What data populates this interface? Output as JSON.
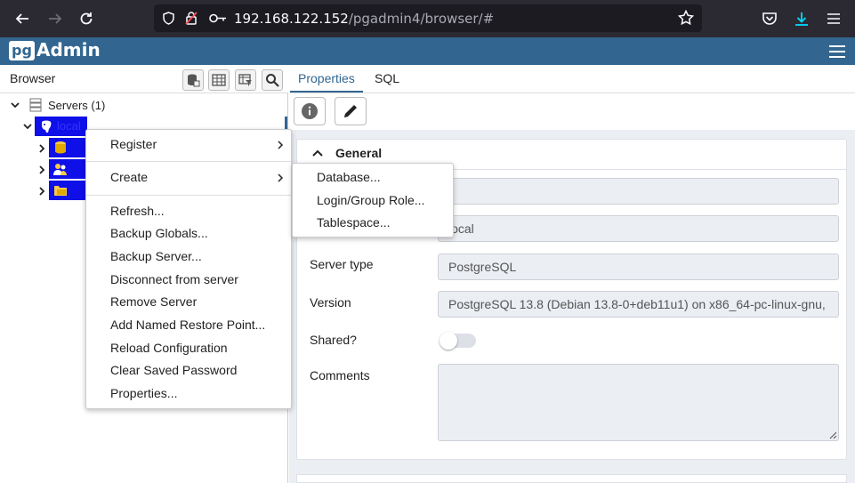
{
  "browser": {
    "url_host": "192.168.122.152",
    "url_path": "/pgadmin4/browser/#"
  },
  "app": {
    "logo_mark": "pg",
    "logo_name": "Admin"
  },
  "browser_panel": {
    "title": "Browser",
    "tree": {
      "servers_label": "Servers (1)",
      "server_label": "local"
    }
  },
  "right_panel": {
    "tabs": [
      {
        "label": "Properties",
        "active": true
      },
      {
        "label": "SQL",
        "active": false
      }
    ],
    "section_title": "General",
    "fields": [
      {
        "label": "",
        "value": ""
      },
      {
        "label": "",
        "value": "local"
      },
      {
        "label": "Server type",
        "value": "PostgreSQL"
      },
      {
        "label": "Version",
        "value": "PostgreSQL 13.8 (Debian 13.8-0+deb11u1) on x86_64-pc-linux-gnu,"
      },
      {
        "label": "Shared?",
        "value": ""
      },
      {
        "label": "Comments",
        "value": ""
      }
    ],
    "shared_toggle_on": false
  },
  "context_menu": {
    "items": [
      "Register",
      "Create",
      "Refresh...",
      "Backup Globals...",
      "Backup Server...",
      "Disconnect from server",
      "Remove Server",
      "Add Named Restore Point...",
      "Reload Configuration",
      "Clear Saved Password",
      "Properties..."
    ]
  },
  "create_submenu": {
    "items": [
      "Database...",
      "Login/Group Role...",
      "Tablespace..."
    ]
  },
  "colors": {
    "header": "#326690",
    "selection": "#0f0fe8",
    "firefox_toolbar": "#2b2a33"
  }
}
